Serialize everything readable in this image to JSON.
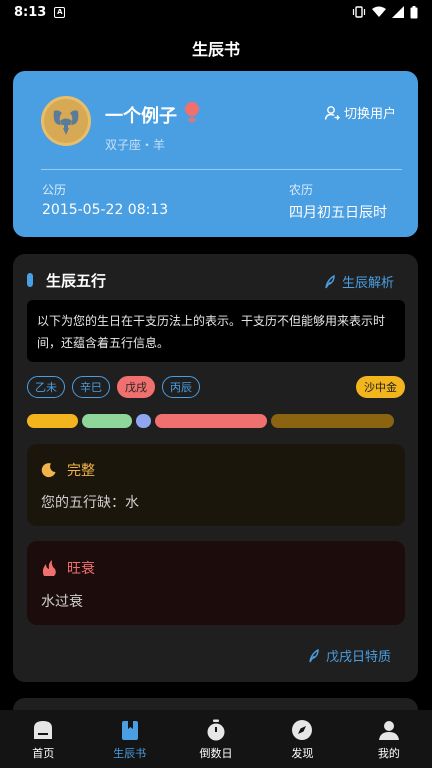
{
  "status_bar": {
    "time": "8:13",
    "notification_icon": "a-icon"
  },
  "header": {
    "title": "生辰书"
  },
  "user": {
    "name": "一个例子",
    "sub": "双子座・羊",
    "switch_label": "切换用户",
    "gregorian_label": "公历",
    "gregorian_value": "2015-05-22 08:13",
    "lunar_label": "农历",
    "lunar_value": "四月初五日辰时",
    "gender_color": "#f07070"
  },
  "wuxing": {
    "title": "生辰五行",
    "analysis_link": "生辰解析",
    "description": "以下为您的生日在干支历法上的表示。干支历不但能够用来表示时间，还蕴含着五行信息。",
    "pillars": [
      {
        "label": "乙未",
        "active": false
      },
      {
        "label": "辛巳",
        "active": false
      },
      {
        "label": "戊戌",
        "active": true
      },
      {
        "label": "丙辰",
        "active": false
      }
    ],
    "nayin": "沙中金",
    "elements": [
      {
        "name": "metal",
        "color": "#f2b51e",
        "share": 0.14
      },
      {
        "name": "wood",
        "color": "#8fd69a",
        "share": 0.14
      },
      {
        "name": "water",
        "color": "#8fa6f0",
        "share": 0.04
      },
      {
        "name": "fire",
        "color": "#f07070",
        "share": 0.31
      },
      {
        "name": "earth",
        "color": "#8a6410",
        "share": 0.34
      }
    ],
    "complete": {
      "title": "完整",
      "text": "您的五行缺：水"
    },
    "strength": {
      "title": "旺衰",
      "text": "水过衰"
    },
    "day_link": "戊戌日特质"
  },
  "nav": {
    "items": [
      {
        "label": "首页",
        "icon": "home-icon",
        "active": false
      },
      {
        "label": "生辰书",
        "icon": "book-icon",
        "active": true
      },
      {
        "label": "倒数日",
        "icon": "stopwatch-icon",
        "active": false
      },
      {
        "label": "发现",
        "icon": "compass-icon",
        "active": false
      },
      {
        "label": "我的",
        "icon": "profile-icon",
        "active": false
      }
    ]
  },
  "colors": {
    "accent": "#4a9ee2",
    "nayin": "#f2b51e"
  }
}
